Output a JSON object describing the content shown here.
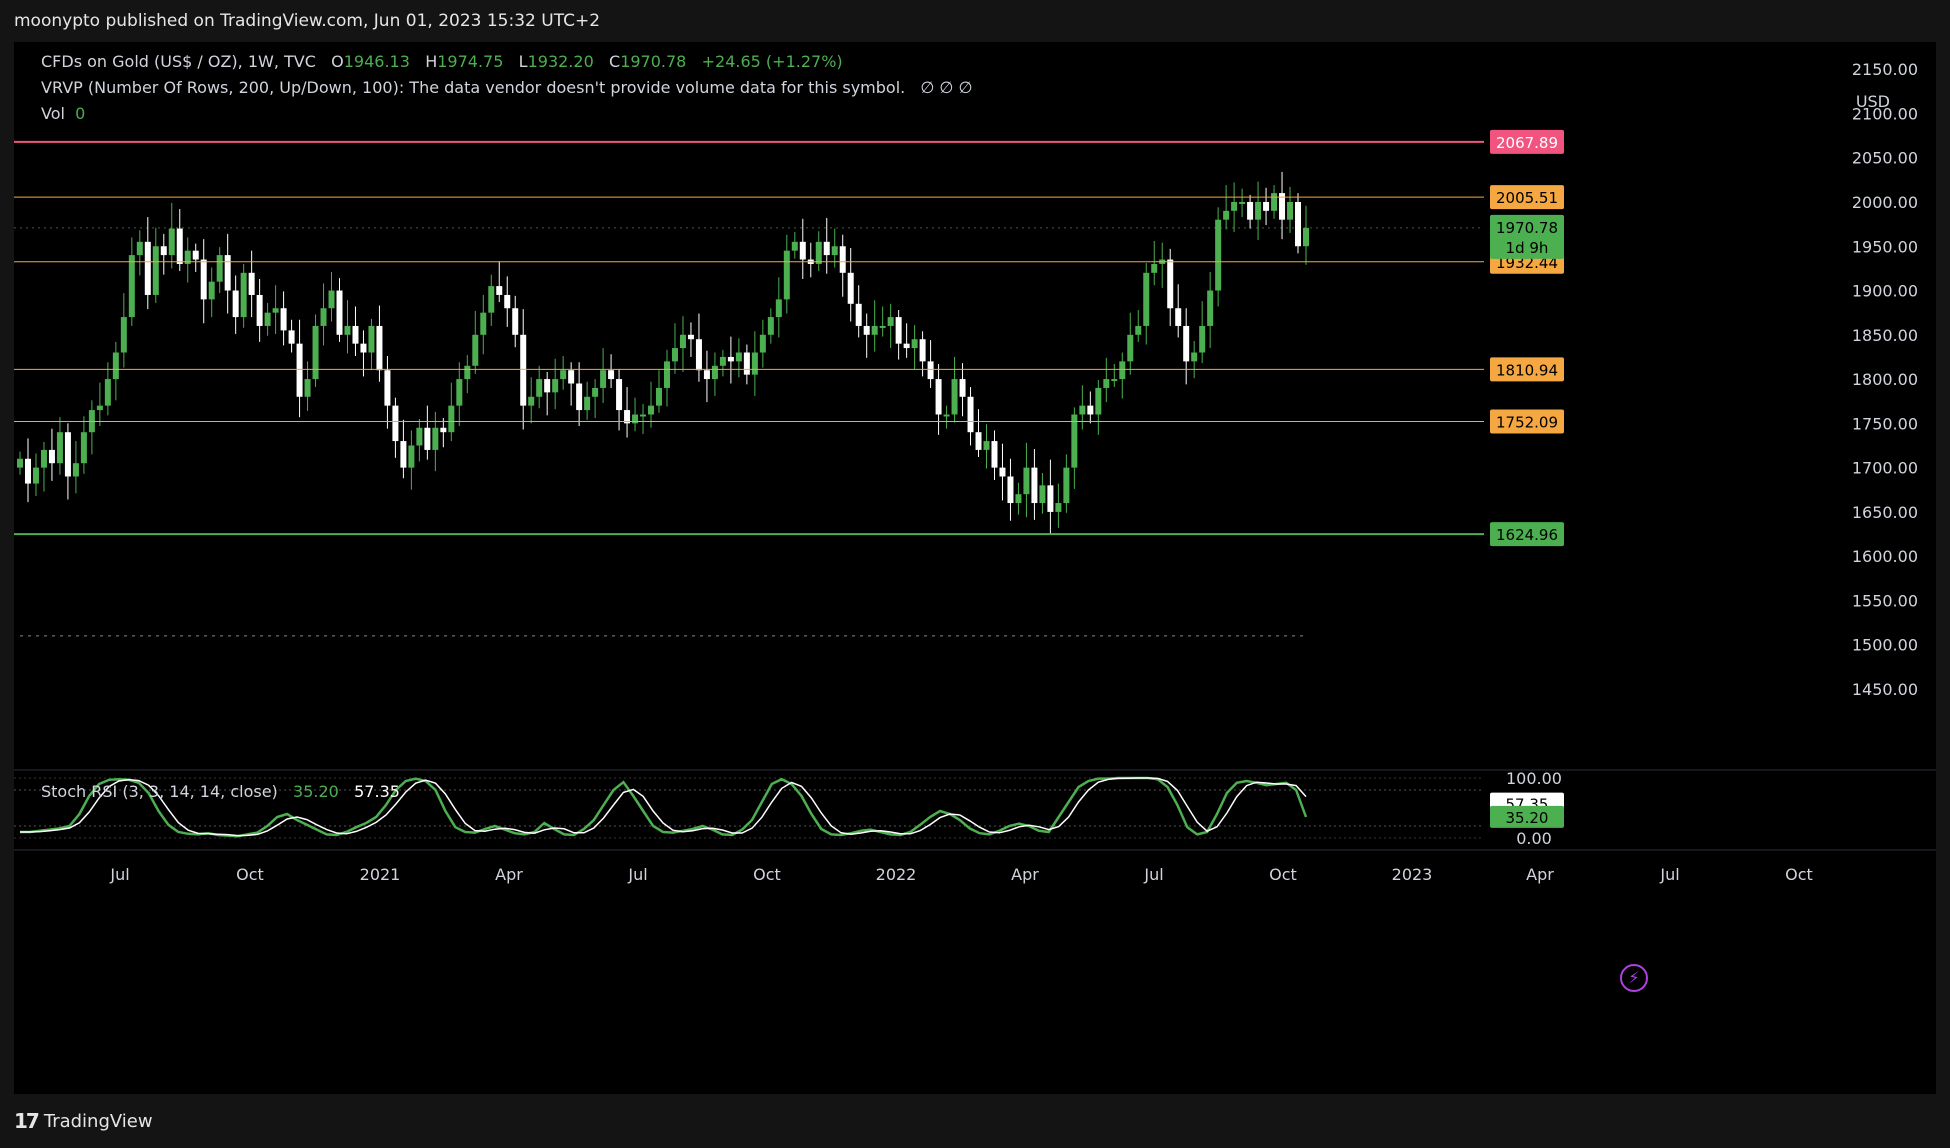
{
  "header": {
    "published": "moonypto published on TradingView.com, Jun 01, 2023 15:32 UTC+2"
  },
  "legend": {
    "symbol": "CFDs on Gold (US$ / OZ), 1W, TVC",
    "o_label": "O",
    "o_value": "1946.13",
    "h_label": "H",
    "h_value": "1974.75",
    "l_label": "L",
    "l_value": "1932.20",
    "c_label": "C",
    "c_value": "1970.78",
    "change": "+24.65 (+1.27%)",
    "vrvp": "VRVP (Number Of Rows, 200, Up/Down, 100): The data vendor doesn't provide volume data for this symbol.",
    "vrvp_icons": "∅   ∅   ∅",
    "vol_label": "Vol",
    "vol_value": "0",
    "stoch_label": "Stoch RSI (3, 3, 14, 14, close)",
    "stoch_k": "35.20",
    "stoch_d": "57.35"
  },
  "axis": {
    "currency": "USD"
  },
  "footer": {
    "brand": "TradingView",
    "logo": "17"
  },
  "colors": {
    "up": "#4caf50",
    "down": "#ffffff",
    "pink": "#f0547f",
    "orange": "#f5a742",
    "green_line": "#4caf50",
    "bg": "#000000"
  },
  "chart_data": {
    "type": "candlestick",
    "timeframe": "1W",
    "price_axis": {
      "min": 1450,
      "max": 2150,
      "ticks": [
        1450,
        1500,
        1550,
        1600,
        1650,
        1700,
        1750,
        1800,
        1850,
        1900,
        1950,
        2000,
        2050,
        2100,
        2150
      ]
    },
    "time_labels": [
      "Jul",
      "Oct",
      "2021",
      "Apr",
      "Jul",
      "Oct",
      "2022",
      "Apr",
      "Jul",
      "Oct",
      "2023",
      "Apr",
      "Jul",
      "Oct"
    ],
    "horizontal_levels": [
      {
        "price": 2067.89,
        "label": "2067.89",
        "color": "pink"
      },
      {
        "price": 2005.51,
        "label": "2005.51",
        "color": "orange"
      },
      {
        "price": 1932.44,
        "label": "1932.44",
        "color": "orange"
      },
      {
        "price": 1810.94,
        "label": "1810.94",
        "color": "orange"
      },
      {
        "price": 1752.09,
        "label": "1752.09",
        "color": "orange"
      },
      {
        "price": 1624.96,
        "label": "1624.96",
        "color": "green"
      }
    ],
    "last_price": {
      "price": 1970.78,
      "label": "1970.78",
      "countdown": "1d 9h"
    },
    "closes": [
      1710,
      1682,
      1700,
      1720,
      1705,
      1740,
      1690,
      1705,
      1740,
      1765,
      1770,
      1800,
      1830,
      1870,
      1940,
      1955,
      1895,
      1950,
      1940,
      1970,
      1930,
      1945,
      1935,
      1890,
      1910,
      1940,
      1900,
      1870,
      1920,
      1895,
      1860,
      1875,
      1880,
      1855,
      1840,
      1780,
      1800,
      1860,
      1880,
      1900,
      1850,
      1860,
      1840,
      1830,
      1860,
      1810,
      1770,
      1730,
      1700,
      1725,
      1745,
      1720,
      1745,
      1740,
      1770,
      1800,
      1815,
      1850,
      1875,
      1905,
      1895,
      1880,
      1850,
      1770,
      1780,
      1800,
      1785,
      1800,
      1810,
      1795,
      1765,
      1780,
      1790,
      1810,
      1800,
      1765,
      1750,
      1760,
      1760,
      1770,
      1790,
      1820,
      1835,
      1850,
      1845,
      1810,
      1800,
      1815,
      1825,
      1820,
      1830,
      1805,
      1830,
      1850,
      1870,
      1890,
      1945,
      1955,
      1935,
      1930,
      1955,
      1940,
      1950,
      1920,
      1885,
      1860,
      1850,
      1860,
      1860,
      1870,
      1840,
      1835,
      1845,
      1820,
      1800,
      1760,
      1760,
      1800,
      1780,
      1740,
      1720,
      1730,
      1700,
      1690,
      1660,
      1670,
      1700,
      1660,
      1680,
      1650,
      1660,
      1700,
      1760,
      1770,
      1760,
      1790,
      1800,
      1800,
      1820,
      1850,
      1860,
      1920,
      1930,
      1935,
      1880,
      1860,
      1820,
      1830,
      1860,
      1900,
      1980,
      1990,
      2000,
      2000,
      1980,
      2000,
      1990,
      2010,
      1980,
      2000,
      1950,
      1970.78
    ],
    "stoch_rsi": {
      "k_value": 35.2,
      "d_value": 57.35,
      "levels": [
        0,
        20,
        80,
        100
      ],
      "k": [
        10,
        10,
        12,
        14,
        16,
        20,
        40,
        70,
        90,
        97,
        98,
        97,
        92,
        75,
        45,
        22,
        10,
        7,
        6,
        8,
        5,
        4,
        3,
        6,
        9,
        20,
        35,
        40,
        30,
        22,
        14,
        6,
        5,
        10,
        18,
        25,
        35,
        55,
        80,
        95,
        99,
        95,
        80,
        45,
        18,
        10,
        9,
        15,
        20,
        14,
        8,
        6,
        10,
        25,
        15,
        6,
        5,
        15,
        30,
        55,
        80,
        93,
        70,
        45,
        20,
        10,
        9,
        12,
        15,
        20,
        14,
        6,
        5,
        14,
        30,
        60,
        90,
        98,
        90,
        70,
        40,
        15,
        6,
        5,
        8,
        12,
        14,
        10,
        6,
        5,
        10,
        22,
        35,
        45,
        40,
        30,
        16,
        8,
        6,
        12,
        20,
        24,
        20,
        12,
        10,
        35,
        60,
        85,
        95,
        99,
        99,
        100,
        100,
        100,
        100,
        98,
        85,
        55,
        18,
        6,
        10,
        40,
        75,
        92,
        95,
        92,
        88,
        90,
        92,
        80,
        35
      ]
    },
    "ylim": [
      1450,
      2150
    ]
  }
}
